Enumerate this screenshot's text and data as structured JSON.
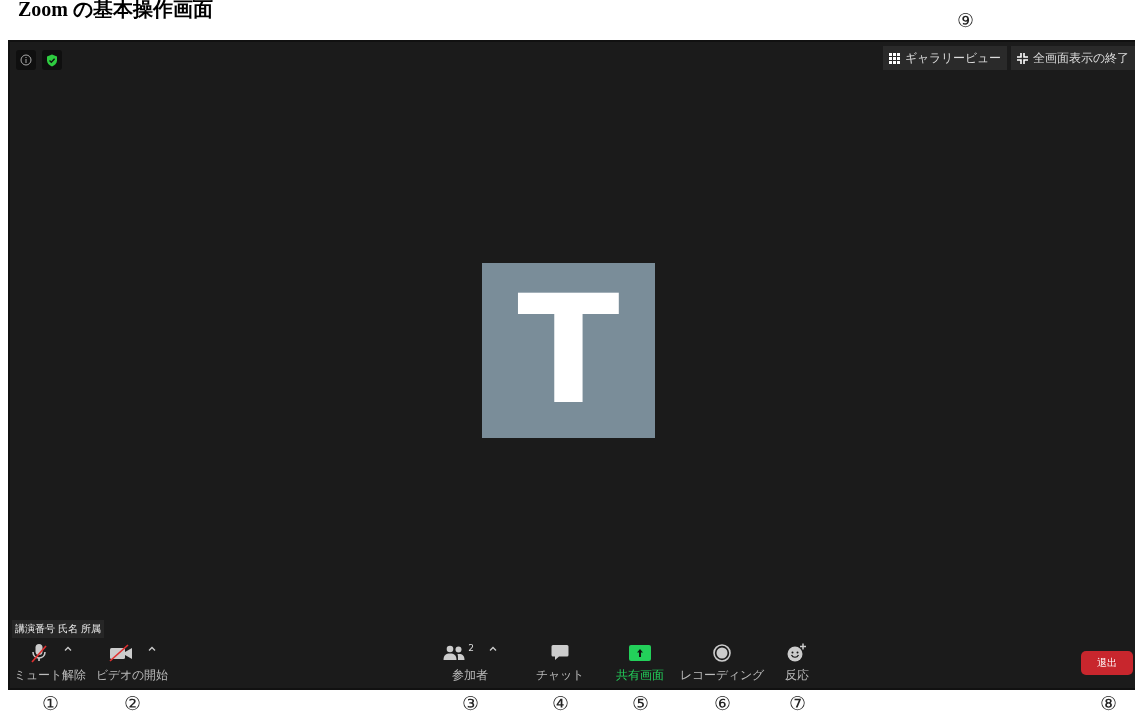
{
  "title": "Zoom の基本操作画面",
  "top_left_icons": [
    {
      "kind": "info"
    },
    {
      "kind": "shield"
    }
  ],
  "top_buttons": [
    {
      "kind": "gallery",
      "label": "ギャラリービュー",
      "marker": "⑨"
    },
    {
      "kind": "exit_fullscreen",
      "label": "全画面表示の終了"
    }
  ],
  "avatar_letter": "T",
  "name_tag": "講演番号 氏名 所属",
  "toolbar": [
    {
      "kind": "mic",
      "label": "ミュート解除",
      "slashed": true,
      "has_menu": true,
      "marker": "①"
    },
    {
      "kind": "video",
      "label": "ビデオの開始",
      "slashed": true,
      "has_menu": true,
      "marker": "②"
    },
    {
      "kind": "participants",
      "label": "参加者",
      "count": "2",
      "has_menu": true,
      "marker": "③"
    },
    {
      "kind": "chat",
      "label": "チャット",
      "marker": "④"
    },
    {
      "kind": "share",
      "label": "共有画面",
      "active": true,
      "marker": "⑤"
    },
    {
      "kind": "record",
      "label": "レコーディング",
      "marker": "⑥"
    },
    {
      "kind": "reactions",
      "label": "反応",
      "marker": "⑦"
    },
    {
      "kind": "leave",
      "label": "退出",
      "marker": "⑧"
    }
  ]
}
